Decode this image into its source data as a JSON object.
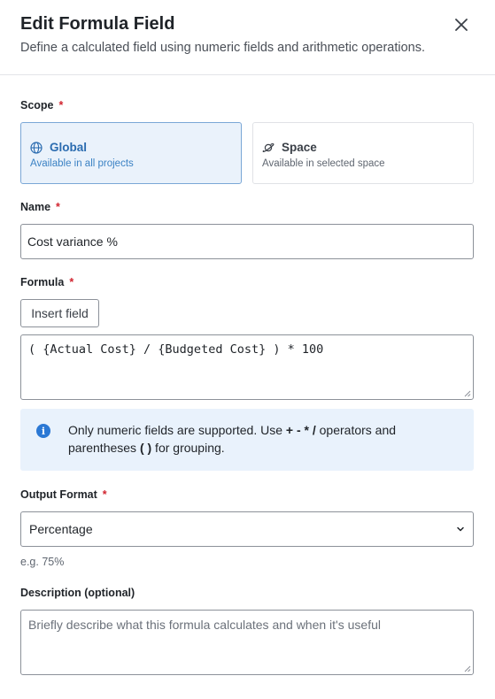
{
  "dialog": {
    "title": "Edit Formula Field",
    "subtitle": "Define a calculated field using numeric fields and arithmetic operations.",
    "close_icon": "close-icon"
  },
  "scope": {
    "label": "Scope",
    "required_mark": "*",
    "options": [
      {
        "title": "Global",
        "description": "Available in all projects",
        "icon": "globe-icon",
        "selected": true
      },
      {
        "title": "Space",
        "description": "Available in selected space",
        "icon": "planet-icon",
        "selected": false
      }
    ]
  },
  "name": {
    "label": "Name",
    "required_mark": "*",
    "value": "Cost variance %"
  },
  "formula": {
    "label": "Formula",
    "required_mark": "*",
    "insert_button": "Insert field",
    "value": "( {Actual Cost} / {Budgeted Cost} ) * 100"
  },
  "info": {
    "icon": "info-icon",
    "text_before": "Only numeric fields are supported. Use ",
    "operators": "+ - * /",
    "text_middle": " operators and parentheses ",
    "parens": "( )",
    "text_after": " for grouping."
  },
  "output_format": {
    "label": "Output Format",
    "required_mark": "*",
    "selected": "Percentage",
    "hint": "e.g. 75%"
  },
  "description": {
    "label": "Description (optional)",
    "placeholder": "Briefly describe what this formula calculates and when it's useful"
  },
  "colors": {
    "accent": "#2b6cb0",
    "selected_bg": "#eaf2fb",
    "info_bg": "#e9f2fc",
    "required": "#d1242f"
  }
}
